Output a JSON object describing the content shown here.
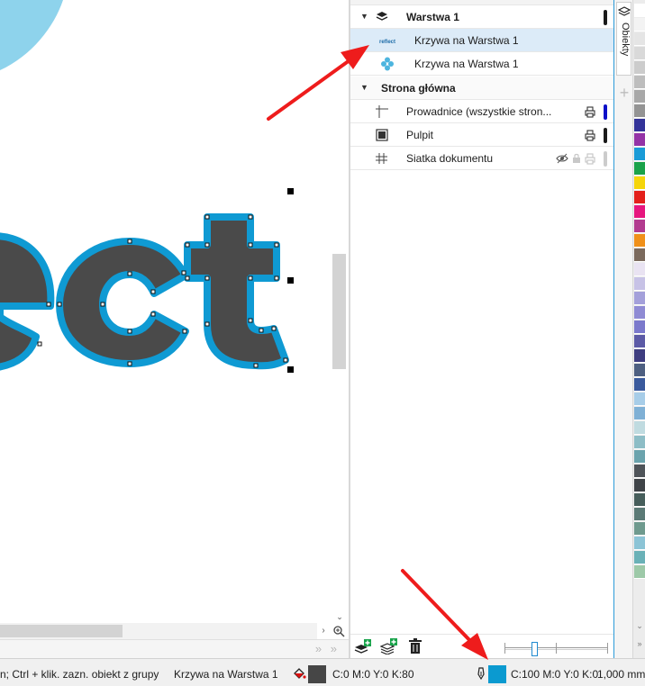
{
  "canvas": {
    "artwork_text": "ect",
    "scroll_right_glyph": "›",
    "scroll_down_glyph": "⌄",
    "nav_arrows": "» »"
  },
  "layers_panel": {
    "layer": {
      "name": "Warstwa 1",
      "items": [
        {
          "label": "Krzywa na Warstwa 1",
          "thumbnail_text": "reflect",
          "selected": true
        },
        {
          "label": "Krzywa na Warstwa 1",
          "thumbnail_icon": "diamond-dots-icon",
          "selected": false
        }
      ]
    },
    "master_page": {
      "name": "Strona główna",
      "items": [
        {
          "label": "Prowadnice (wszystkie stron...",
          "icon": "guides-icon",
          "color": "#0b10c8"
        },
        {
          "label": "Pulpit",
          "icon": "desktop-icon",
          "color": "#1a1a1a"
        },
        {
          "label": "Siatka dokumentu",
          "icon": "grid-icon",
          "color": "#cccccc"
        }
      ]
    },
    "toolbar": {
      "buttons": [
        "new-layer-icon",
        "new-master-layer-icon",
        "delete-icon"
      ]
    }
  },
  "dock": {
    "tab_label": "Obiekty",
    "add_label": "+"
  },
  "palette": {
    "colors": [
      "#ffffff",
      "#f3f3f3",
      "#e5e5e5",
      "#d9d9d9",
      "#cccccc",
      "#bdbdbd",
      "#a8a8a8",
      "#949494",
      "#333399",
      "#9433a6",
      "#1a9bd7",
      "#1aa24a",
      "#f5d50b",
      "#e3201b",
      "#e6167e",
      "#b23b8f",
      "#f09019",
      "#7b6a5d",
      "#e9e3f2",
      "#c7c2e6",
      "#a4a0da",
      "#8f8bd4",
      "#7b79cc",
      "#5c5aa6",
      "#3e3d80",
      "#4d5f81",
      "#3a5a9d",
      "#a7cde8",
      "#7fb0d5",
      "#c0dbe0",
      "#8dbdc6",
      "#6ba3ad",
      "#4f5459",
      "#3f4448",
      "#465e5b",
      "#5b7a76",
      "#6f9a8e",
      "#8cc4d6",
      "#6ab1b7",
      "#9dc9a8"
    ],
    "scroll_down_glyph": "⌄",
    "scroll_end_glyph": "»"
  },
  "status_bar": {
    "hint": "n; Ctrl + klik. zazn. obiekt z grupy",
    "object": "Krzywa na Warstwa 1",
    "fill_color": "#464646",
    "fill_value": "C:0 M:0 Y:0 K:80",
    "outline_color": "#0b9ad0",
    "outline_value": "C:100 M:0 Y:0 K:0",
    "outline_width": "1,000 mm"
  }
}
